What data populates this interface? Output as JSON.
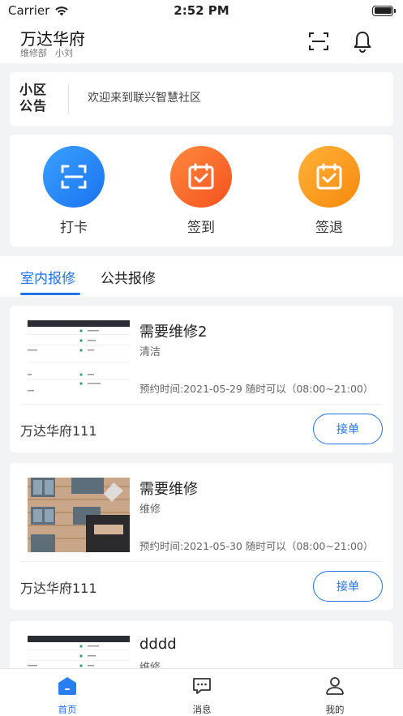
{
  "status_bar": {
    "carrier": "Carrier",
    "time": "2:52 PM"
  },
  "header": {
    "title": "万达华府",
    "department": "维修部",
    "user": "小刘",
    "icons": [
      "scan-icon",
      "bell-icon"
    ]
  },
  "notice": {
    "tag": "小区公告",
    "text": "欢迎来到联兴智慧社区"
  },
  "actions": [
    {
      "label": "打卡",
      "icon": "scan-icon",
      "color_from": "#3aa0ff",
      "color_to": "#1a73f0"
    },
    {
      "label": "签到",
      "icon": "calendar-check-icon",
      "color_from": "#ff8a3d",
      "color_to": "#f4511e"
    },
    {
      "label": "签退",
      "icon": "calendar-check-icon",
      "color_from": "#ffb23a",
      "color_to": "#f7890c"
    }
  ],
  "tabs": [
    {
      "label": "室内报修",
      "active": true
    },
    {
      "label": "公共报修",
      "active": false
    }
  ],
  "orders": [
    {
      "title": "需要维修2",
      "category": "清洁",
      "time": "预约时间:2021-05-29 随时可以（08:00~21:00）",
      "place": "万达华府111",
      "action": "接单"
    },
    {
      "title": "需要维修",
      "category": "维修",
      "time": "预约时间:2021-05-30 随时可以（08:00~21:00）",
      "place": "万达华府111",
      "action": "接单"
    },
    {
      "title": "dddd",
      "category": "维修"
    }
  ],
  "tabbar": [
    {
      "label": "首页",
      "icon": "home-icon",
      "active": true
    },
    {
      "label": "消息",
      "icon": "message-icon",
      "active": false
    },
    {
      "label": "我的",
      "icon": "user-icon",
      "active": false
    }
  ],
  "colors": {
    "accent": "#2173e8",
    "background": "#f2f3f5"
  }
}
